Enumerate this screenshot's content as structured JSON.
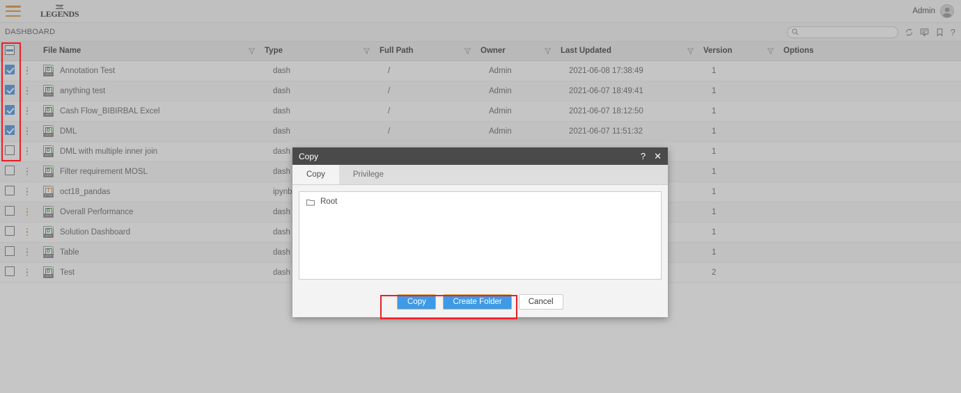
{
  "topbar": {
    "menu_icon": "hamburger-icon",
    "logo_top": "THE",
    "logo_main": "LEGENDS",
    "admin_label": "Admin",
    "avatar_icon": "user-avatar-icon"
  },
  "crumbbar": {
    "breadcrumb": "DASHBOARD",
    "search": {
      "value": "",
      "placeholder": ""
    },
    "icons": [
      "search-icon",
      "refresh-icon",
      "comment-icon",
      "bookmark-icon",
      "help-icon"
    ],
    "help_glyph": "?"
  },
  "table": {
    "headers": [
      "File Name",
      "Type",
      "Full Path",
      "Owner",
      "Last Updated",
      "Version",
      "Options"
    ],
    "header_checkbox_state": "indeterminate",
    "rows": [
      {
        "checked": true,
        "kebab": "grey",
        "icon": "dash-file-icon",
        "tag": "DASH",
        "name": "Annotation Test",
        "type": "dash",
        "path": "/",
        "owner": "Admin",
        "updated": "2021-06-08 17:38:49",
        "version": "1",
        "options": ""
      },
      {
        "checked": true,
        "kebab": "grey",
        "icon": "dash-file-icon",
        "tag": "DASH",
        "name": "anything test",
        "type": "dash",
        "path": "/",
        "owner": "Admin",
        "updated": "2021-06-07 18:49:41",
        "version": "1",
        "options": ""
      },
      {
        "checked": true,
        "kebab": "grey",
        "icon": "dash-file-icon",
        "tag": "DASH",
        "name": "Cash Flow_BIBIRBAL Excel",
        "type": "dash",
        "path": "/",
        "owner": "Admin",
        "updated": "2021-06-07 18:12:50",
        "version": "1",
        "options": ""
      },
      {
        "checked": true,
        "kebab": "grey",
        "icon": "dash-file-icon",
        "tag": "DASH",
        "name": "DML",
        "type": "dash",
        "path": "/",
        "owner": "Admin",
        "updated": "2021-06-07 11:51:32",
        "version": "1",
        "options": ""
      },
      {
        "checked": false,
        "kebab": "grey",
        "icon": "dash-file-icon",
        "tag": "DASH",
        "name": "DML with multiple inner join",
        "type": "dash",
        "path": "",
        "owner": "",
        "updated": "",
        "version": "1",
        "options": ""
      },
      {
        "checked": false,
        "kebab": "grey",
        "icon": "dash-file-icon",
        "tag": "DASH",
        "name": "Filter requirement MOSL",
        "type": "dash",
        "path": "",
        "owner": "",
        "updated": "",
        "version": "1",
        "options": ""
      },
      {
        "checked": false,
        "kebab": "grey",
        "icon": "ipynb-file-icon",
        "tag": "IPYNB",
        "name": "oct18_pandas",
        "type": "ipynb",
        "path": "",
        "owner": "",
        "updated": "",
        "version": "1",
        "options": ""
      },
      {
        "checked": false,
        "kebab": "orange",
        "icon": "dash-file-icon",
        "tag": "DASH",
        "name": "Overall Performance",
        "type": "dash",
        "path": "",
        "owner": "",
        "updated": "",
        "version": "1",
        "options": ""
      },
      {
        "checked": false,
        "kebab": "orange",
        "icon": "dash-file-icon",
        "tag": "DASH",
        "name": "Solution Dashboard",
        "type": "dash",
        "path": "",
        "owner": "",
        "updated": "",
        "version": "1",
        "options": ""
      },
      {
        "checked": false,
        "kebab": "grey",
        "icon": "dash-file-icon",
        "tag": "DASH",
        "name": "Table",
        "type": "dash",
        "path": "",
        "owner": "",
        "updated": "",
        "version": "1",
        "options": ""
      },
      {
        "checked": false,
        "kebab": "grey",
        "icon": "dash-file-icon",
        "tag": "DASH",
        "name": "Test",
        "type": "dash",
        "path": "",
        "owner": "",
        "updated": "",
        "version": "2",
        "options": ""
      }
    ]
  },
  "modal": {
    "title": "Copy",
    "help_glyph": "?",
    "close_glyph": "✕",
    "tabs": [
      {
        "label": "Copy",
        "active": true
      },
      {
        "label": "Privilege",
        "active": false
      }
    ],
    "tree": [
      {
        "label": "Root",
        "icon": "folder-icon"
      }
    ],
    "buttons": {
      "copy": "Copy",
      "create_folder": "Create Folder",
      "cancel": "Cancel"
    }
  },
  "annotations": {
    "colors": {
      "highlight": "#ee1c25",
      "primary_button": "#3c9ae8",
      "button_border": "#e0a94f",
      "accent": "#d98b2b"
    }
  }
}
